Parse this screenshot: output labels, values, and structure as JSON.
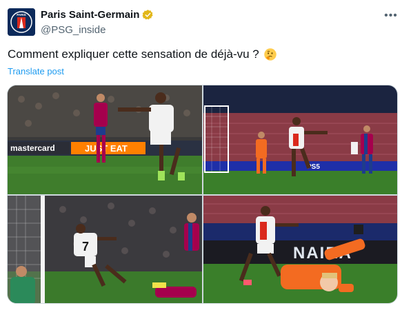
{
  "author": {
    "display_name": "Paris Saint-Germain",
    "handle": "@PSG_inside",
    "avatar_icon": "psg-crest-icon",
    "avatar_text": "PARIS",
    "verified_color": "#e2b719"
  },
  "menu": {
    "more_label": "•••"
  },
  "tweet": {
    "text": "Comment expliquer cette sensation de déjà-vu ?",
    "emoji": "thinking-face-icon",
    "translate_label": "Translate post"
  },
  "media": {
    "board_1": "mastercard",
    "board_2": "JUST EAT",
    "board_3": "PS5",
    "board_4": "NAIRA",
    "shirt_number": "7"
  },
  "colors": {
    "accent": "#1d9bf0",
    "text": "#0f1419",
    "muted": "#536471",
    "pitch": "#2f7d32"
  }
}
